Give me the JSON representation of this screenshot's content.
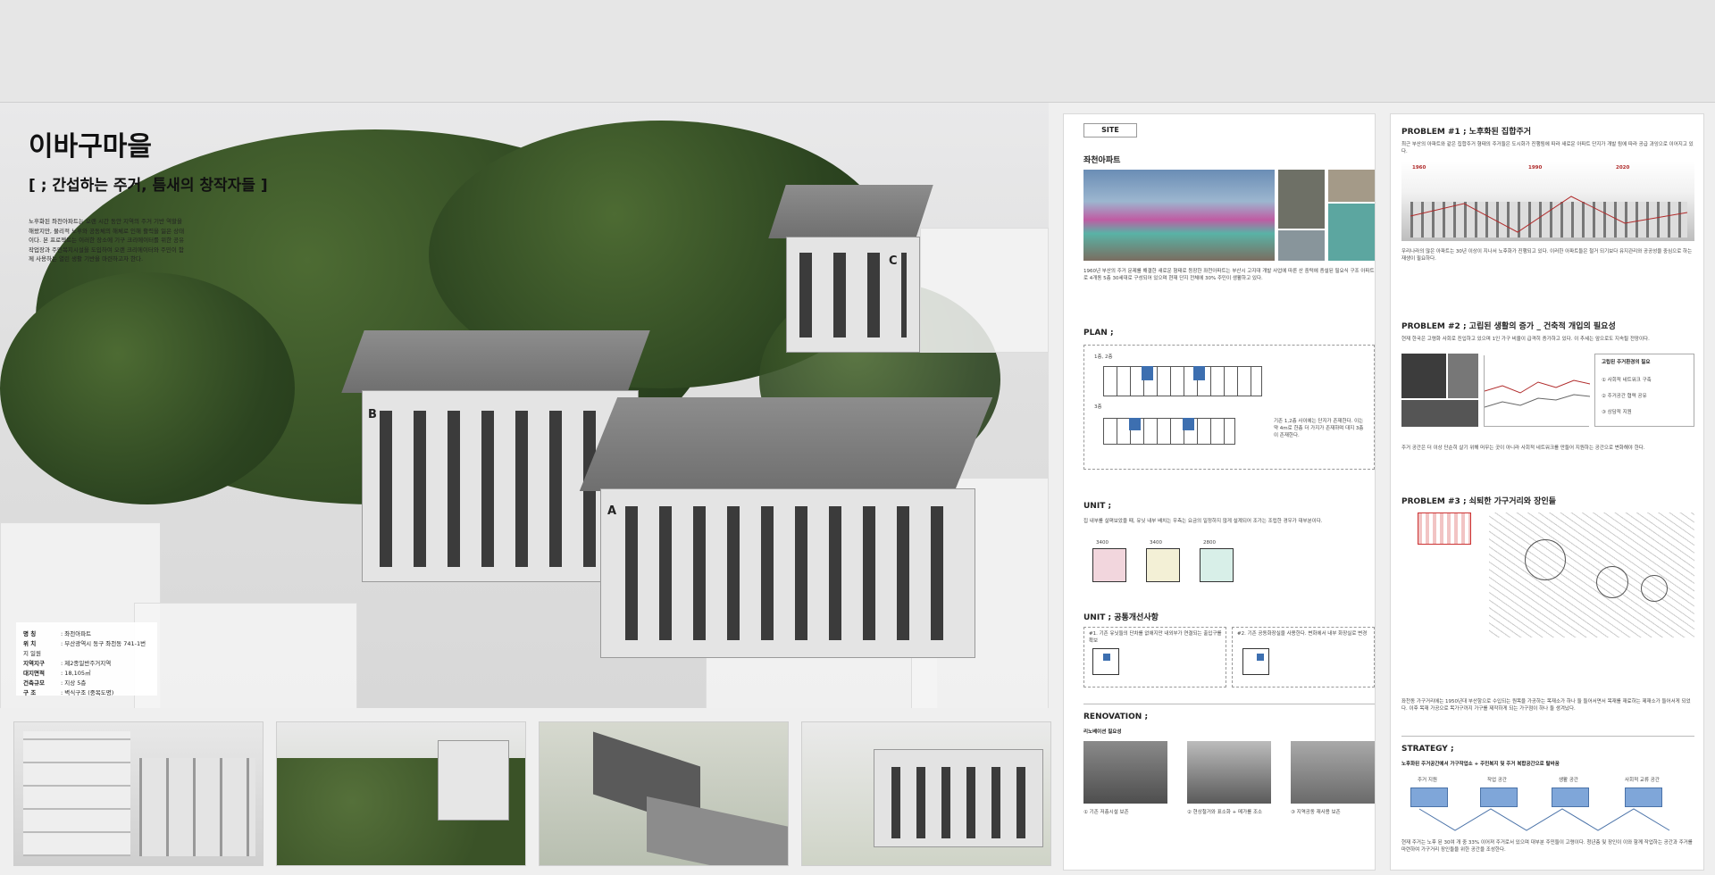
{
  "board": {
    "title": "이바구마을",
    "subtitle": "[ ; 간섭하는 주거, 틈새의 창작자들 ]",
    "intro": "노후화된 좌천아파트는 오랜 시간 동안 지역의 주거 기반 역할을 해왔지만, 물리적 노후와 공동체의 해체로 인해 활력을 잃은 상태이다. 본 프로젝트는 이러한 장소에 기구 크리에이터를 위한 공유작업장과 주민복지시설을 도입하여 오랜 크리에이터와 주민이 함께 사용하는 열린 생활 기반을 마련하고자 한다.",
    "spec": [
      {
        "k": "명    칭",
        "v": "좌천아파트"
      },
      {
        "k": "위    치",
        "v": "부산광역시 동구 좌천동 741-1번지 일원"
      },
      {
        "k": "지역지구",
        "v": "제2종일반주거지역"
      },
      {
        "k": "대지면적",
        "v": "18,105㎡"
      },
      {
        "k": "건축규모",
        "v": "지상 5층"
      },
      {
        "k": "구    조",
        "v": "벽식구조 (중목도명)"
      }
    ],
    "building_labels": [
      "A",
      "B",
      "C"
    ]
  },
  "site": {
    "tag": "SITE",
    "heading": "좌천아파트",
    "text": "1960년 부산의 주거 문제를 해결한 새로운 형태로 등장한 좌천아파트는 부산시 고지대 개발 사업에 따른 산 중턱에 증설된 필요식 구조 아파트로 4개동 5층 30세대로 구성되어 있으며 현재 단지 전체에 30% 주민이 생활하고 있다."
  },
  "plan": {
    "heading": "PLAN ;",
    "label_a": "1층, 2층",
    "label_b": "3층",
    "note": "기존 1,2층 사이에는 단지가 존재한다. 이는 약 4m로 한층 더 가지가 존재하며 대지 3층이 존재한다."
  },
  "unit": {
    "heading": "UNIT ;",
    "text": "집 내부를 살펴보았을 때, 유닛 내부 배치는 우측는 요금의 일정하지 않게 설계되어 조가는 조립한 경우가 대부분이다.",
    "dims": [
      "3400",
      "3400",
      "2800"
    ]
  },
  "unit2": {
    "heading": "UNIT ; 공통개선사항",
    "item1": "#1. 기존 유닛들의 단차를 없애지만 내외부가 연결되는 출입구를 확보",
    "item2": "#2. 기존 공동화장실을 사용한다. 변화에서 내부 화장실로 변경"
  },
  "renovation": {
    "heading": "RENOVATION ;",
    "sub": "리노베이션 필요성",
    "captions": [
      "① 기존 저층시설 보존",
      "② 현상철거와 표소화 + 메가를 조소",
      "③ 지역공동 재사용 보존"
    ]
  },
  "p1": {
    "heading": "PROBLEM #1 ; 노후화된 집합주거",
    "text": "최근 부산의 아파트와 같은 집합주거 형태의 주거들은 도시화가 진행됨에 따라 새로운 아파트 단지가 개발 됨에 따라 공급 과잉으로 이어지고 있다.",
    "text2": "우리나라의 많은 아파트는 30년 이상이 지나서 노후화가 진행되고 있다. 이러한 아파트들은 철거 되기보다 유지관리와 공공성을 중심으로 하는 재생이 필요하다.",
    "years": [
      "1960",
      "1990",
      "2020"
    ]
  },
  "p2": {
    "heading": "PROBLEM #2 ; 고립된 생활의 증가 _ 건축적 개입의 필요성",
    "text": "현재 한국은 고령화 사회로 진입하고 있으며 1인 가구 비율이 급격히 증가하고 있다. 이 추세는 앞으로도 지속될 전망이다.",
    "box_title": "고립된 주거환경의 필요",
    "box_items": [
      "① 사회적 네트워크 구축",
      "② 주거공간 협력 공유",
      "③ 상담적 지원"
    ],
    "text2": "주거 공간은 더 이상 단순히 살기 위해 머무는 곳이 아니라 사회적 네트워크를 만들어 지원하는 공간으로 변화해야 한다."
  },
  "p3": {
    "heading": "PROBLEM #3 ; 쇠퇴한 가구거리와 장인들",
    "text": "좌천동 가구거리에는 1950년대 부산항으로 수입되는 원목을 가공하는 목재소가 하나 둘 들어서면서 목재를 재료하는 제재소가 들어서게 되었다. 이후 목재 가공으로 목가구까지 가구를 제작하게 되는 가구점이 하나 둘 생겨났다."
  },
  "strategy": {
    "heading": "STRATEGY ;",
    "sub": "노후화된 주거공간에서 가구작업소 + 주민복지 및 주거 복합공간으로 탈바꿈",
    "steps": [
      "주거 지원",
      "작업 공간",
      "생활 공간",
      "사회적 교류 공간"
    ],
    "text": "현재 주거는 노후 된 30여 개 중 33% 이어져 주거로서 있으며 대부분 주민들이 고령이다. 청년층 및 장인이 이와 함께 작업하는 공간과 주거를 마련하여 가구거리 장인들을 위한 공간을 조성한다."
  }
}
